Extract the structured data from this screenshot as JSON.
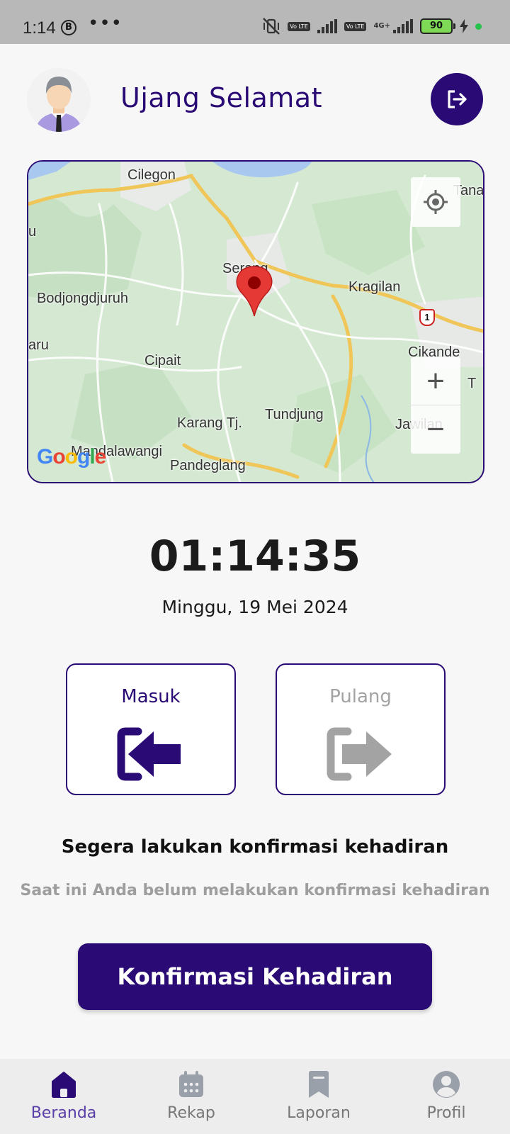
{
  "status_bar": {
    "time": "1:14",
    "notif_badge": "B",
    "more": "•••",
    "lte_badge": "Vo LTE",
    "network": "4G+",
    "battery": "90"
  },
  "header": {
    "user_name": "Ujang Selamat",
    "avatar_icon": "user-avatar-icon",
    "logout_icon": "logout-icon"
  },
  "map": {
    "labels": {
      "cilegon": "Cilegon",
      "tanara": "Tanar",
      "u": "u",
      "serang": "Serang",
      "kragilan": "Kragilan",
      "bodjong": "Bodjongdjuruh",
      "aru": "aru",
      "cikande": "Cikande",
      "cipait": "Cipait",
      "t": "T",
      "tundjung": "Tundjung",
      "karang": "Karang Tj.",
      "jawilan": "Jawilan",
      "mandalawangi": "Mandalawangi",
      "pandeglang": "Pandeglang",
      "route_1": "1"
    },
    "google_logo": "Google",
    "zoom_in": "+",
    "zoom_out": "−",
    "locate_icon": "my-location-icon",
    "pin_icon": "map-pin-icon"
  },
  "clock": {
    "time": "01:14:35",
    "date": "Minggu, 19 Mei 2024"
  },
  "cards": {
    "masuk_label": "Masuk",
    "pulang_label": "Pulang"
  },
  "message": {
    "headline": "Segera lakukan konfirmasi kehadiran",
    "subline": "Saat ini Anda belum melakukan konfirmasi kehadiran"
  },
  "confirm_button": "Konfirmasi Kehadiran",
  "bottom_nav": {
    "items": [
      {
        "label": "Beranda",
        "icon": "home-icon",
        "active": true
      },
      {
        "label": "Rekap",
        "icon": "calendar-icon",
        "active": false
      },
      {
        "label": "Laporan",
        "icon": "bookmark-icon",
        "active": false
      },
      {
        "label": "Profil",
        "icon": "profile-icon",
        "active": false
      }
    ]
  },
  "colors": {
    "primary": "#2a0a74",
    "inactive": "#a3a3a3",
    "background": "#f6f7f6"
  }
}
